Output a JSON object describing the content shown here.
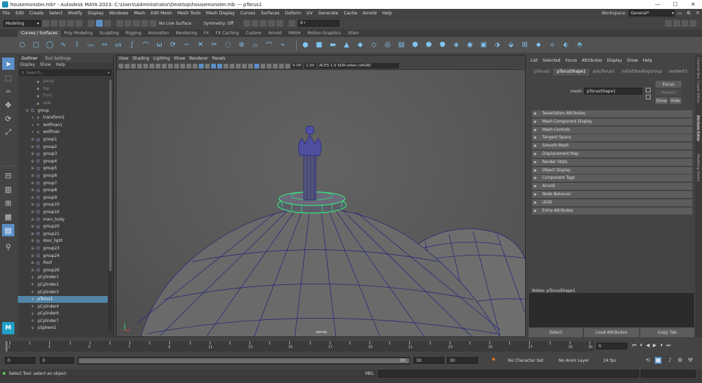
{
  "window": {
    "title": "housemonster.mb* - Autodesk MAYA 2023: C:\\Users\\Administrator\\Desktop\\housemonster.mb   ---   pTorus1",
    "controls": [
      "—",
      "☐",
      "✕"
    ]
  },
  "menubar": {
    "items": [
      "File",
      "Edit",
      "Create",
      "Select",
      "Modify",
      "Display",
      "Windows",
      "Mesh",
      "Edit Mesh",
      "Mesh Tools",
      "Mesh Display",
      "Curves",
      "Surfaces",
      "Deform",
      "UV",
      "Generate",
      "Cache",
      "Arnold",
      "Help"
    ],
    "workspace_label": "Workspace:",
    "workspace_value": "General*",
    "window_controls": [
      "▭",
      "⧉",
      "✕"
    ]
  },
  "statusline": {
    "mode": "Modeling",
    "live_surface": "No Live Surface",
    "symmetry": "Symmetry: Off",
    "name_field": "d r"
  },
  "shelf": {
    "tabs": [
      "Curves / Surfaces",
      "Poly Modeling",
      "Sculpting",
      "Rigging",
      "Animation",
      "Rendering",
      "FX",
      "FX Caching",
      "Custom",
      "Arnold",
      "MASH",
      "Motion Graphics",
      "XGen"
    ],
    "active_tab": 0,
    "icons": [
      "○",
      "□",
      "◯",
      "∿",
      "⌇",
      "〰",
      "∾",
      "ᔕ",
      "∫",
      "⌒",
      "ω",
      "⟳",
      "∽",
      "✕",
      "✂",
      "◌",
      "⊕",
      "⌓",
      "⌒",
      "⌁",
      "●",
      "■",
      "▬",
      "▲",
      "◆",
      "◇",
      "◎",
      "▤",
      "⬢",
      "⬟",
      "⬣",
      "◈",
      "◉",
      "▣",
      "⬗",
      "⬙",
      "⊞",
      "⬥",
      "⟡",
      "⬖",
      "⬘"
    ]
  },
  "toolbox": {
    "tools": [
      "➤",
      "⬚",
      "⌯",
      "✥",
      "⟳",
      "⤢"
    ],
    "layouts": [
      "⊟",
      "▥",
      "⊞",
      "▦",
      "▤"
    ],
    "search": "⚲",
    "logo": "M"
  },
  "outliner": {
    "tabs": [
      "Outliner",
      "Tool Settings"
    ],
    "menu": [
      "Display",
      "Show",
      "Help"
    ],
    "search_placeholder": "Search...",
    "rows": [
      {
        "label": "persp",
        "type": "cam",
        "indent": 18,
        "expand": ""
      },
      {
        "label": "top",
        "type": "cam",
        "indent": 18,
        "expand": ""
      },
      {
        "label": "front",
        "type": "cam",
        "indent": 18,
        "expand": ""
      },
      {
        "label": "side",
        "type": "cam",
        "indent": 18,
        "expand": ""
      },
      {
        "label": "group",
        "type": "group",
        "indent": 10,
        "expand": "⊟"
      },
      {
        "label": "transform1",
        "type": "node",
        "indent": 18,
        "expand": "+"
      },
      {
        "label": "wolfman1",
        "type": "node",
        "indent": 18,
        "expand": "+"
      },
      {
        "label": "wolfman",
        "type": "node",
        "indent": 18,
        "expand": "+"
      },
      {
        "label": "group1",
        "type": "group",
        "indent": 18,
        "expand": "⊞"
      },
      {
        "label": "group2",
        "type": "group",
        "indent": 18,
        "expand": "⊞"
      },
      {
        "label": "group3",
        "type": "group",
        "indent": 18,
        "expand": "⊞"
      },
      {
        "label": "group4",
        "type": "group",
        "indent": 18,
        "expand": "⊞"
      },
      {
        "label": "group5",
        "type": "group",
        "indent": 18,
        "expand": "⊞"
      },
      {
        "label": "group6",
        "type": "group",
        "indent": 18,
        "expand": "⊞"
      },
      {
        "label": "group7",
        "type": "group",
        "indent": 18,
        "expand": "⊞"
      },
      {
        "label": "group8",
        "type": "group",
        "indent": 18,
        "expand": "⊞"
      },
      {
        "label": "group9",
        "type": "group",
        "indent": 18,
        "expand": "⊞"
      },
      {
        "label": "group10",
        "type": "group",
        "indent": 18,
        "expand": "⊞"
      },
      {
        "label": "group16",
        "type": "group",
        "indent": 18,
        "expand": "⊞"
      },
      {
        "label": "main_body",
        "type": "group",
        "indent": 18,
        "expand": "⊞"
      },
      {
        "label": "group20",
        "type": "group",
        "indent": 18,
        "expand": "⊞"
      },
      {
        "label": "group21",
        "type": "group",
        "indent": 18,
        "expand": "⊞"
      },
      {
        "label": "door_light",
        "type": "group",
        "indent": 18,
        "expand": "⊞"
      },
      {
        "label": "group23",
        "type": "group",
        "indent": 18,
        "expand": "⊞"
      },
      {
        "label": "group24",
        "type": "group",
        "indent": 18,
        "expand": "⊞"
      },
      {
        "label": "Roof",
        "type": "group",
        "indent": 18,
        "expand": "⊞"
      },
      {
        "label": "group26",
        "type": "group",
        "indent": 18,
        "expand": "⊞"
      },
      {
        "label": "pCylinder1",
        "type": "mesh",
        "indent": 10,
        "expand": ""
      },
      {
        "label": "pCylinder2",
        "type": "mesh",
        "indent": 10,
        "expand": ""
      },
      {
        "label": "pCylinder3",
        "type": "mesh",
        "indent": 10,
        "expand": ""
      },
      {
        "label": "pTorus1",
        "type": "mesh",
        "indent": 10,
        "expand": "",
        "selected": true
      },
      {
        "label": "pCylinder4",
        "type": "mesh",
        "indent": 10,
        "expand": ""
      },
      {
        "label": "pCylinder6",
        "type": "mesh",
        "indent": 10,
        "expand": ""
      },
      {
        "label": "pCylinder7",
        "type": "mesh",
        "indent": 10,
        "expand": ""
      },
      {
        "label": "pSphere1",
        "type": "mesh",
        "indent": 10,
        "expand": ""
      }
    ]
  },
  "viewport": {
    "menu": [
      "View",
      "Shading",
      "Lighting",
      "Show",
      "Renderer",
      "Panels"
    ],
    "exposure": "0.00",
    "gamma": "1.00",
    "color_space": "ACES 1.0 SDR-video (sRGB)",
    "camera_label": "persp"
  },
  "attribute_editor": {
    "menu": [
      "List",
      "Selected",
      "Focus",
      "Attributes",
      "Display",
      "Show",
      "Help"
    ],
    "tabs": [
      "pTorus1",
      "pTorusShape1",
      "polyTorus1",
      "initialShadingGroup",
      "lambert1"
    ],
    "active_tab": 1,
    "mesh_label": "mesh:",
    "mesh_value": "pTorusShape1",
    "focus_btn": "Focus",
    "presets_btn": "Presets",
    "show_btn": "Show",
    "hide_btn": "Hide",
    "sections": [
      "Tessellation Attributes",
      "Mesh Component Display",
      "Mesh Controls",
      "Tangent Space",
      "Smooth Mesh",
      "Displacement Map",
      "Render Stats",
      "Object Display",
      "Component Tags",
      "Arnold",
      "Node Behavior",
      "UUID",
      "Extra Attributes"
    ],
    "notes_label": "Notes:  pTorusShape1",
    "bottom_buttons": [
      "Select",
      "Load Attributes",
      "Copy Tab"
    ]
  },
  "side_tabs": [
    "Channel Box / Layer Editor",
    "Attribute Editor",
    "Modeling Toolkit"
  ],
  "timeslider": {
    "start": 1,
    "end": 30,
    "step": 1,
    "current_frame": "0",
    "controls": [
      "⏮",
      "⏴",
      "◀",
      "▶",
      "⏵",
      "⏭"
    ]
  },
  "range": {
    "start": "0",
    "anim_start": "0",
    "range_start": "0",
    "range_end": "30",
    "anim_end": "30",
    "end": "30",
    "character_set": "No Character Set",
    "anim_layer": "No Anim Layer",
    "fps": "24 fps"
  },
  "commandline": {
    "help_text": "Select Tool: select an object",
    "mel_label": "MEL"
  }
}
